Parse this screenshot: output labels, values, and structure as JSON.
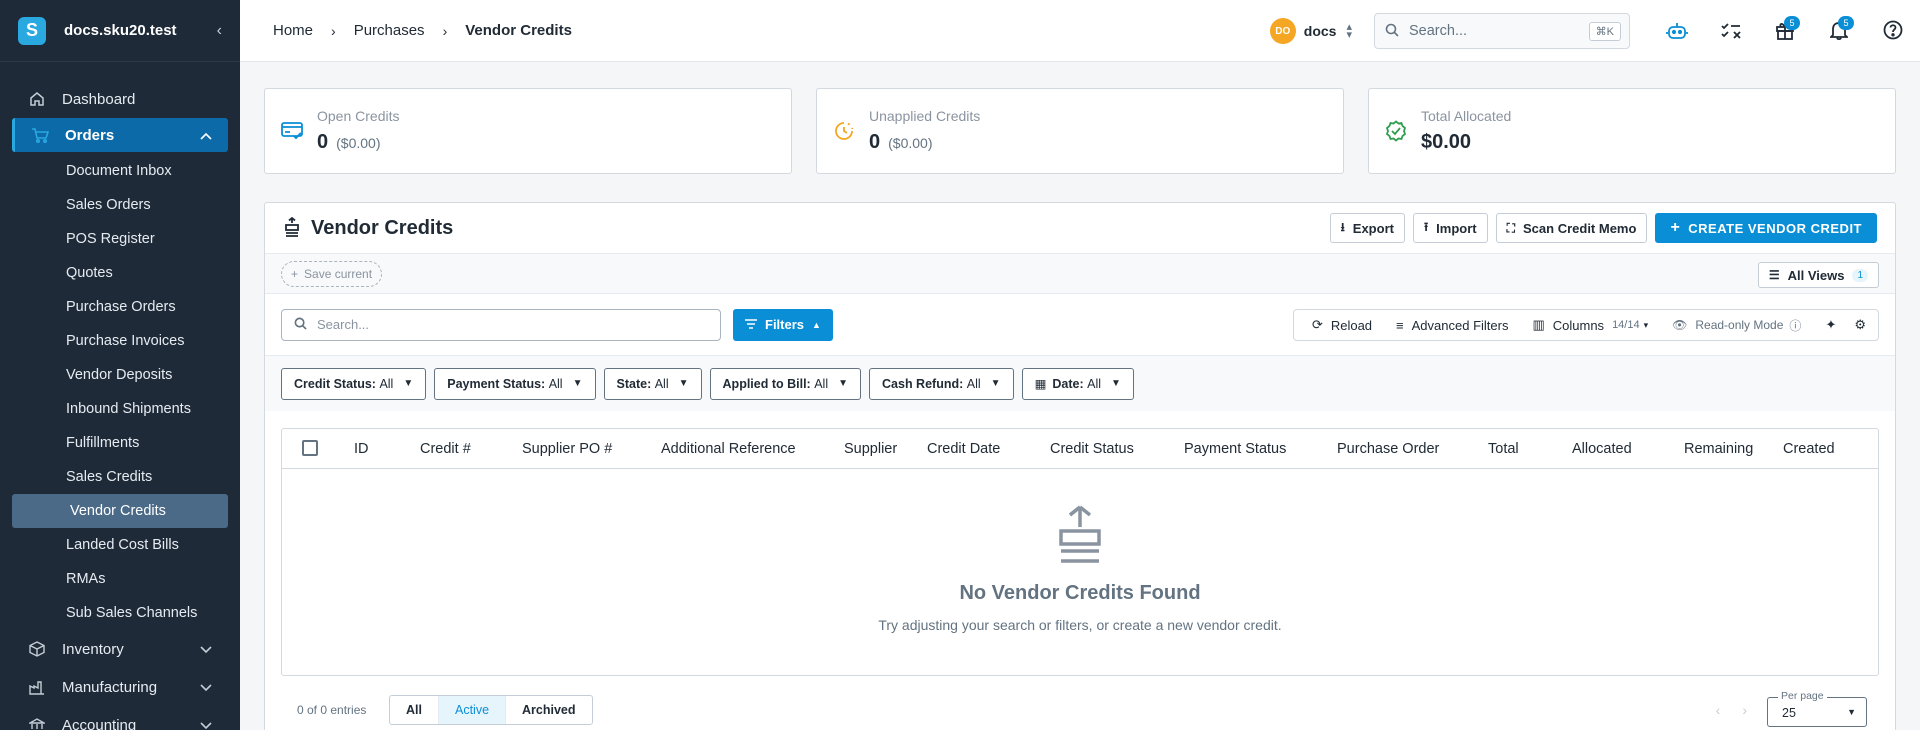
{
  "sidebar": {
    "domain": "docs.sku20.test",
    "logo_letter": "S",
    "items": [
      {
        "label": "Dashboard",
        "icon": "home-icon"
      },
      {
        "label": "Orders",
        "icon": "cart-icon"
      }
    ],
    "orders_sub": [
      "Document Inbox",
      "Sales Orders",
      "POS Register",
      "Quotes",
      "Purchase Orders",
      "Purchase Invoices",
      "Vendor Deposits",
      "Inbound Shipments",
      "Fulfillments",
      "Sales Credits",
      "Vendor Credits",
      "Landed Cost Bills",
      "RMAs",
      "Sub Sales Channels"
    ],
    "groups": [
      {
        "label": "Inventory",
        "icon": "cube-icon"
      },
      {
        "label": "Manufacturing",
        "icon": "factory-icon"
      },
      {
        "label": "Accounting",
        "icon": "bank-icon"
      }
    ]
  },
  "breadcrumb": [
    "Home",
    "Purchases",
    "Vendor Credits"
  ],
  "topbar": {
    "account_initials": "DO",
    "account_name": "docs",
    "search_placeholder": "Search...",
    "search_shortcut": "⌘K",
    "gift_badge": "5",
    "bell_badge": "5"
  },
  "stats": [
    {
      "label": "Open Credits",
      "value": "0",
      "sub": "($0.00)",
      "icon": "credit-card-icon",
      "color": "#0a8fd6"
    },
    {
      "label": "Unapplied Credits",
      "value": "0",
      "sub": "($0.00)",
      "icon": "clock-icon",
      "color": "#f5a623"
    },
    {
      "label": "Total Allocated",
      "value": "$0.00",
      "sub": "",
      "icon": "check-badge-icon",
      "color": "#2e9e4f"
    }
  ],
  "page": {
    "title": "Vendor Credits",
    "export_label": "Export",
    "import_label": "Import",
    "scan_label": "Scan Credit Memo",
    "create_label": "CREATE VENDOR CREDIT",
    "save_current_label": "Save current",
    "all_views_label": "All Views",
    "all_views_count": "1",
    "table_search_placeholder": "Search...",
    "filters_label": "Filters",
    "reload_label": "Reload",
    "advanced_filters_label": "Advanced Filters",
    "columns_label": "Columns",
    "columns_count": "14/14",
    "readonly_label": "Read-only Mode"
  },
  "filters": [
    {
      "label": "Credit Status:",
      "value": "All"
    },
    {
      "label": "Payment Status:",
      "value": "All"
    },
    {
      "label": "State:",
      "value": "All"
    },
    {
      "label": "Applied to Bill:",
      "value": "All"
    },
    {
      "label": "Cash Refund:",
      "value": "All"
    },
    {
      "label": "Date:",
      "value": "All"
    }
  ],
  "columns": [
    "ID",
    "Credit #",
    "Supplier PO #",
    "Additional Reference",
    "Supplier",
    "Credit Date",
    "Credit Status",
    "Payment Status",
    "Purchase Order",
    "Total",
    "Allocated",
    "Remaining",
    "Created"
  ],
  "empty": {
    "title": "No Vendor Credits Found",
    "subtitle": "Try adjusting your search or filters, or create a new vendor credit."
  },
  "footer": {
    "entries": "0 of 0 entries",
    "tabs": [
      "All",
      "Active",
      "Archived"
    ],
    "active_tab": "Active",
    "per_page_label": "Per page",
    "per_page_value": "25"
  }
}
